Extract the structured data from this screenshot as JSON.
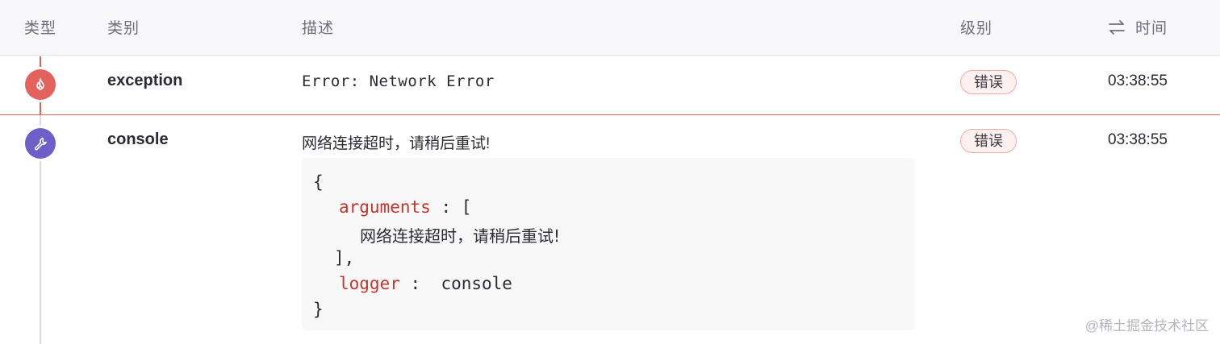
{
  "header": {
    "type": "类型",
    "category": "类别",
    "description": "描述",
    "level": "级别",
    "time": "时间"
  },
  "events": [
    {
      "icon": "flame-icon",
      "color": "#e4625d",
      "category": "exception",
      "description": "Error: Network Error",
      "level": "错误",
      "time": "03:38:55"
    },
    {
      "icon": "wrench-icon",
      "color": "#6c5fc7",
      "category": "console",
      "description": "网络连接超时，请稍后重试!",
      "level": "错误",
      "time": "03:38:55",
      "code": {
        "open_brace": "{",
        "arguments_key": "arguments",
        "arguments_sep": " : [",
        "arguments_value": "网络连接超时，请稍后重试!",
        "arguments_close": "],",
        "logger_key": "logger",
        "logger_sep": " :  ",
        "logger_value": "console",
        "close_brace": "}"
      }
    }
  ],
  "watermark": "@稀土掘金技术社区",
  "colors": {
    "error": "#e4625d",
    "console": "#6c5fc7",
    "code_key": "#c4352e",
    "badge_border": "#f1a9a6"
  }
}
